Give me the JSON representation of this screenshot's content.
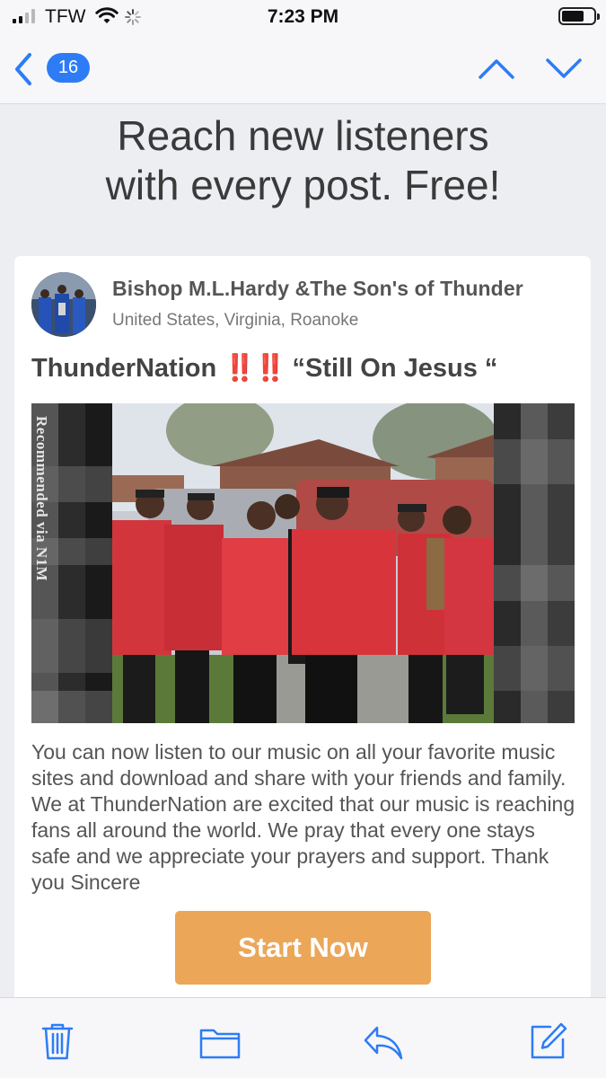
{
  "status_bar": {
    "carrier": "TFW",
    "time": "7:23 PM",
    "icons": [
      "cellular-signal-icon",
      "wifi-icon",
      "loading-spinner-icon",
      "battery-icon"
    ]
  },
  "nav": {
    "message_count": "16",
    "icons": [
      "chevron-left-icon",
      "chevron-up-icon",
      "chevron-down-icon"
    ]
  },
  "headline": "Reach new listeners\nwith every post. Free!",
  "post": {
    "author": "Bishop M.L.Hardy &The Son's of Thunder",
    "location": "United States, Virginia, Roanoke",
    "title_prefix": "ThunderNation",
    "title_emphasis": "‼️‼️",
    "title_suffix": "“Still On Jesus “",
    "watermark": "Recommended via N1M",
    "body": "You can now listen to our music on all your favorite music sites and download and share with your friends and family. We at ThunderNation are excited that our music is reaching fans all around the world. We pray that every one stays safe and we appreciate your prayers and support. Thank you Sincere",
    "cta_label": "Start Now"
  },
  "toolbar": {
    "icons": [
      "trash-icon",
      "folder-icon",
      "reply-icon",
      "compose-icon"
    ]
  },
  "colors": {
    "accent_blue": "#2d7cf6",
    "cta_orange": "#eca657",
    "emphasis_red": "#dd2222",
    "page_background": "#eceef2"
  }
}
